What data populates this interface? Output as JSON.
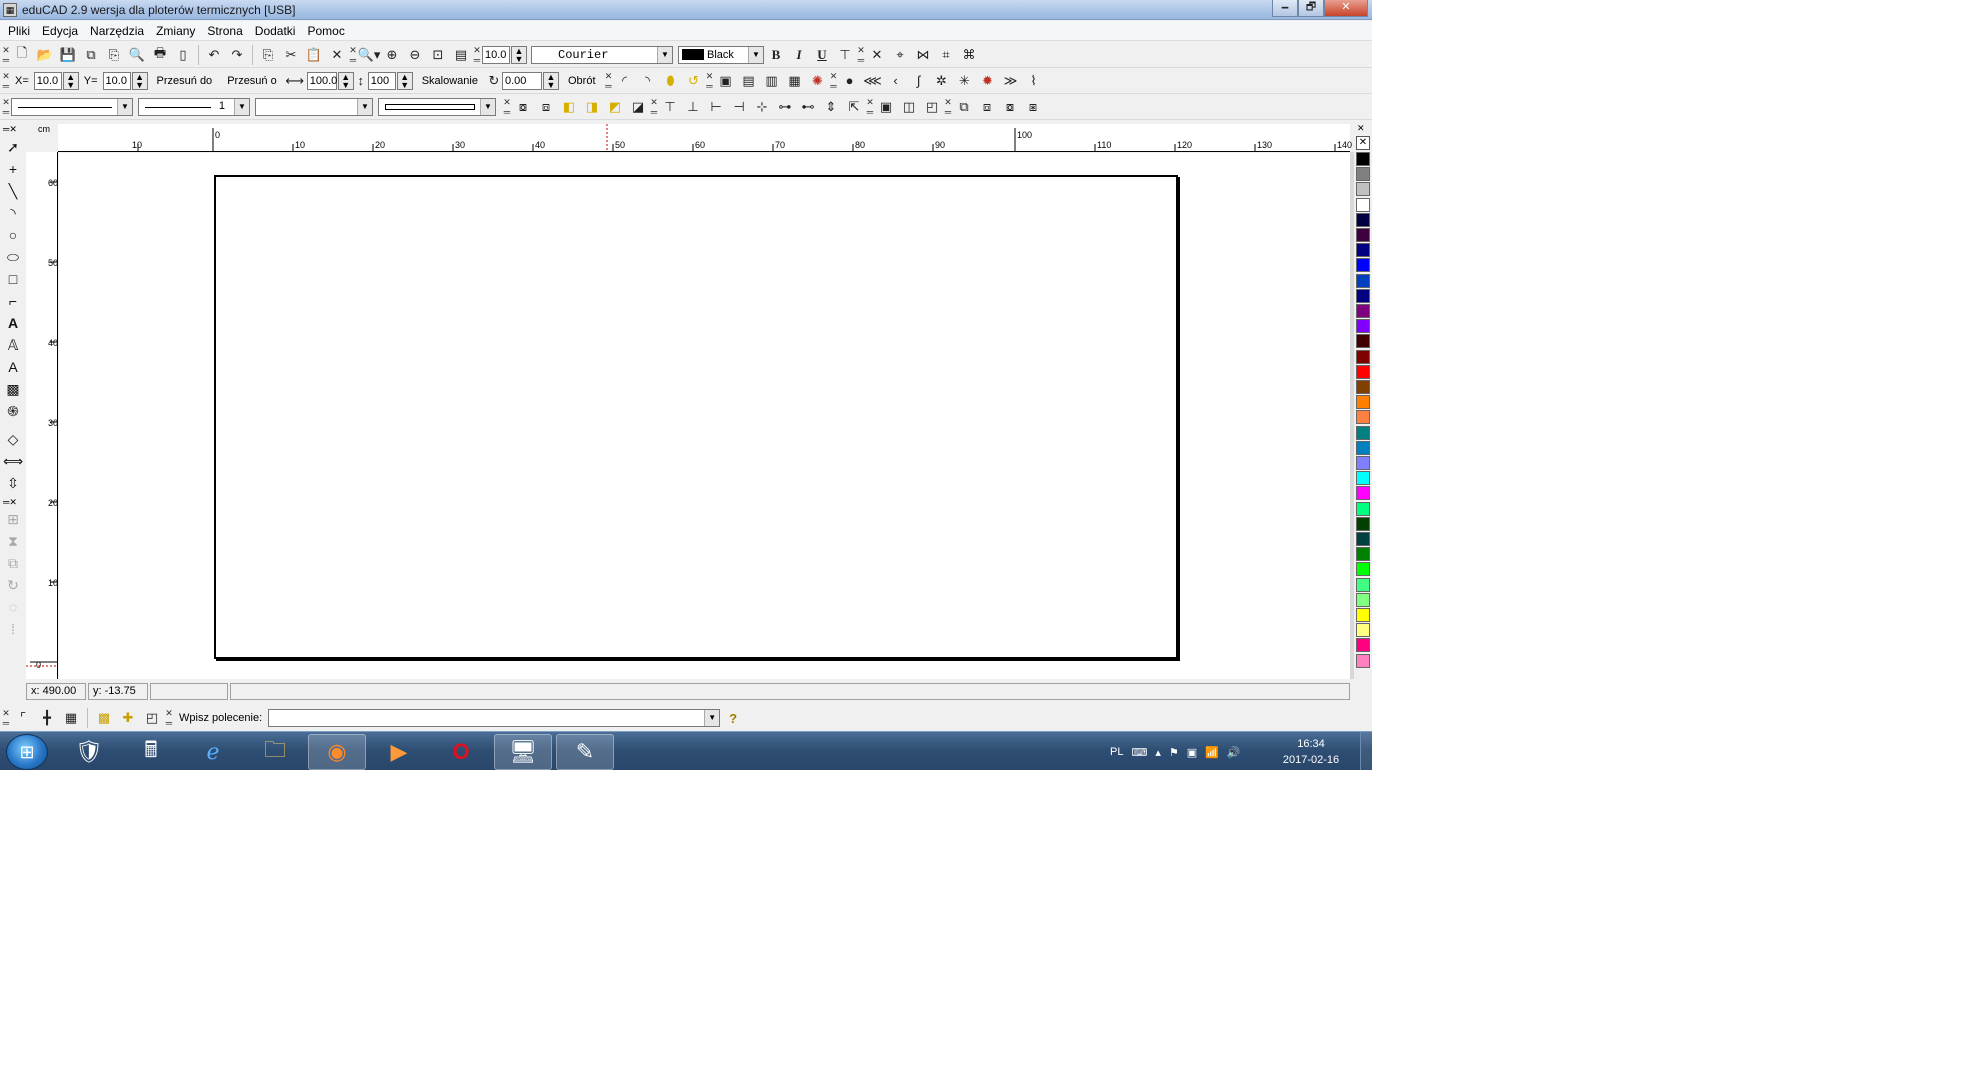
{
  "window": {
    "title": "eduCAD 2.9 wersja dla ploterów termicznych [USB]",
    "min": "🗕",
    "max": "🗗",
    "close": "✕"
  },
  "menu": [
    "Pliki",
    "Edycja",
    "Narzędzia",
    "Zmiany",
    "Strona",
    "Dodatki",
    "Pomoc"
  ],
  "toolbar1": {
    "font_size": "10.0",
    "font_name": "Courier",
    "color_name": "Black",
    "bold": "B",
    "italic": "I",
    "underline": "U"
  },
  "toolbar2": {
    "x_label": "X=",
    "x_value": "10.0",
    "y_label": "Y=",
    "y_value": "10.0",
    "move_to": "Przesuń do",
    "move_by": "Przesuń o",
    "scale_w": "100.0",
    "scale_h": "100",
    "scale_label": "Skalowanie",
    "rotate_value": "0.00",
    "rotate_label": "Obrót"
  },
  "toolbar3": {
    "line_width": "1"
  },
  "ruler": {
    "unit": "cm",
    "top_ticks": [
      "10",
      "0",
      "10",
      "20",
      "30",
      "40",
      "50",
      "60",
      "70",
      "80",
      "90",
      "100",
      "110",
      "120",
      "130",
      "140"
    ],
    "left_ticks": [
      "60",
      "50",
      "40",
      "30",
      "20",
      "10",
      "0"
    ]
  },
  "status": {
    "x": "x: 490.00",
    "y": "y: -13.75"
  },
  "command": {
    "label": "Wpisz polecenie:",
    "value": "",
    "help": "?"
  },
  "palette": [
    "#000000",
    "#808080",
    "#c0c0c0",
    "#ffffff",
    "#000040",
    "#400040",
    "#000080",
    "#0000ff",
    "#0040c0",
    "#000080",
    "#800080",
    "#8000ff",
    "#400000",
    "#800000",
    "#ff0000",
    "#804000",
    "#ff8000",
    "#ff8040",
    "#008080",
    "#0080c0",
    "#8080ff",
    "#00ffff",
    "#ff00ff",
    "#00ff80",
    "#004000",
    "#004040",
    "#008000",
    "#00ff00",
    "#40ff80",
    "#80ff80",
    "#ffff00",
    "#ffff80",
    "#ff0080",
    "#ff80c0"
  ],
  "taskbar": {
    "lang": "PL",
    "time": "16:34",
    "date": "2017-02-16"
  }
}
